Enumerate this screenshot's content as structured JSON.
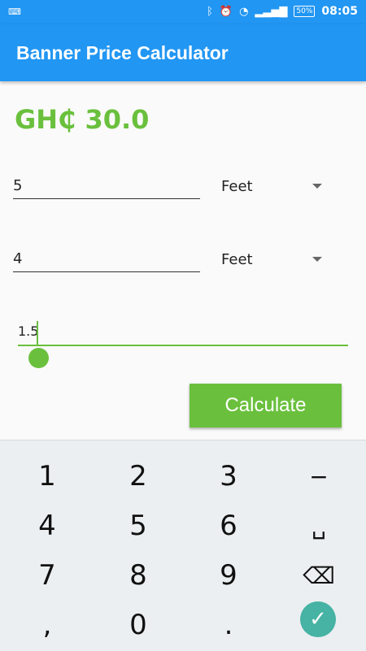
{
  "status_bar": {
    "time": "08:05",
    "battery": "50%"
  },
  "app": {
    "title": "Banner Price Calculator"
  },
  "price": {
    "text": "GH₵ 30.0"
  },
  "inputs": {
    "width": {
      "value": "5",
      "unit": "Feet"
    },
    "height": {
      "value": "4",
      "unit": "Feet"
    }
  },
  "slider": {
    "value": "1.5"
  },
  "actions": {
    "calculate": "Calculate"
  },
  "keyboard": {
    "rows": [
      [
        "1",
        "2",
        "3",
        "−"
      ],
      [
        "4",
        "5",
        "6",
        "␣"
      ],
      [
        "7",
        "8",
        "9",
        "⌫"
      ],
      [
        ",",
        "0",
        ".",
        "✓"
      ]
    ]
  }
}
